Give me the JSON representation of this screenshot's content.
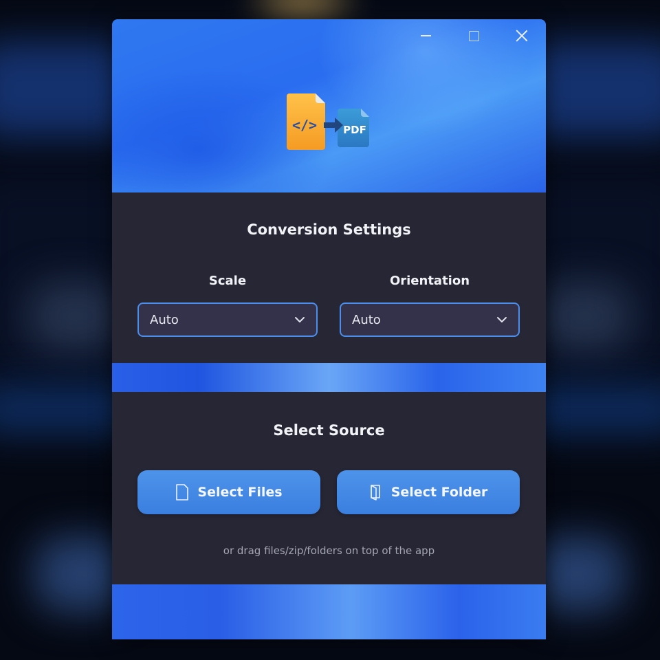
{
  "window": {
    "controls": {
      "minimize_icon": "minimize-icon",
      "maximize_icon": "maximize-icon",
      "close_icon": "close-icon"
    },
    "logo": {
      "badge_text": "PDF",
      "code_glyph": "</>"
    }
  },
  "settings": {
    "title": "Conversion Settings",
    "scale": {
      "label": "Scale",
      "value": "Auto"
    },
    "orientation": {
      "label": "Orientation",
      "value": "Auto"
    }
  },
  "source": {
    "title": "Select Source",
    "select_files_label": "Select Files",
    "select_folder_label": "Select Folder",
    "hint": "or drag files/zip/folders on top of the app"
  },
  "colors": {
    "accent": "#4a8ff0",
    "panel": "#272634",
    "button": "#4a8fe8"
  }
}
